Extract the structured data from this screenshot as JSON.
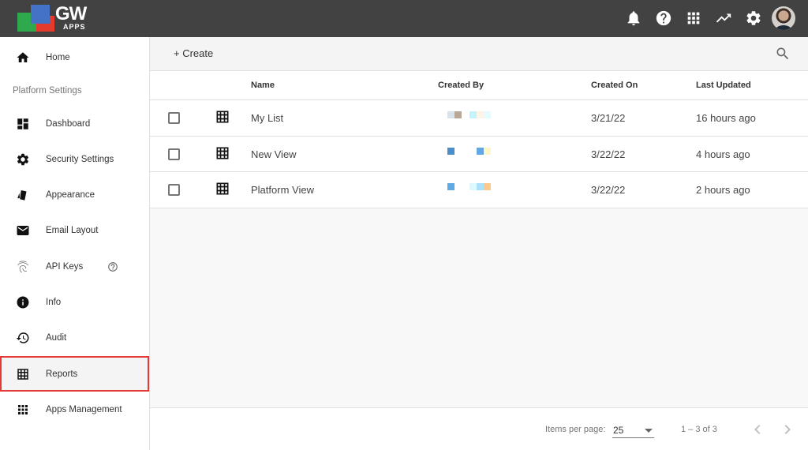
{
  "app": {
    "logo_text": "GW",
    "logo_subtext": "APPS",
    "brand_colors": {
      "green": "#2eaa4d",
      "blue": "#4472c4",
      "red": "#e53b2c"
    }
  },
  "topbar": {
    "icons": [
      "bell-icon",
      "help-icon",
      "apps-grid-icon",
      "trending-icon",
      "gear-icon",
      "avatar"
    ]
  },
  "sidebar": {
    "home_label": "Home",
    "section_label": "Platform Settings",
    "items": [
      {
        "label": "Dashboard",
        "icon": "dashboard-icon"
      },
      {
        "label": "Security Settings",
        "icon": "gear-icon"
      },
      {
        "label": "Appearance",
        "icon": "palette-cards-icon"
      },
      {
        "label": "Email Layout",
        "icon": "mail-icon"
      },
      {
        "label": "API Keys",
        "icon": "fingerprint-icon"
      },
      {
        "label": "Info",
        "icon": "info-icon"
      },
      {
        "label": "Audit",
        "icon": "history-icon"
      },
      {
        "label": "Reports",
        "icon": "table-grid-icon",
        "active": true
      },
      {
        "label": "Apps Management",
        "icon": "apps-icon"
      }
    ],
    "active_highlight_color": "#e53935"
  },
  "toolbar": {
    "create_label": "+ Create"
  },
  "table": {
    "columns": [
      "Name",
      "Created By",
      "Created On",
      "Last Updated"
    ],
    "rows": [
      {
        "name": "My List",
        "created_by": "[redacted]",
        "created_on": "3/21/22",
        "last_updated": "16 hours ago"
      },
      {
        "name": "New View",
        "created_by": "[redacted]",
        "created_on": "3/22/22",
        "last_updated": "4 hours ago"
      },
      {
        "name": "Platform View",
        "created_by": "[redacted]",
        "created_on": "3/22/22",
        "last_updated": "2 hours ago"
      }
    ]
  },
  "paginator": {
    "items_per_page_label": "Items per page:",
    "items_per_page_value": "25",
    "range_label": "1 – 3 of 3"
  }
}
